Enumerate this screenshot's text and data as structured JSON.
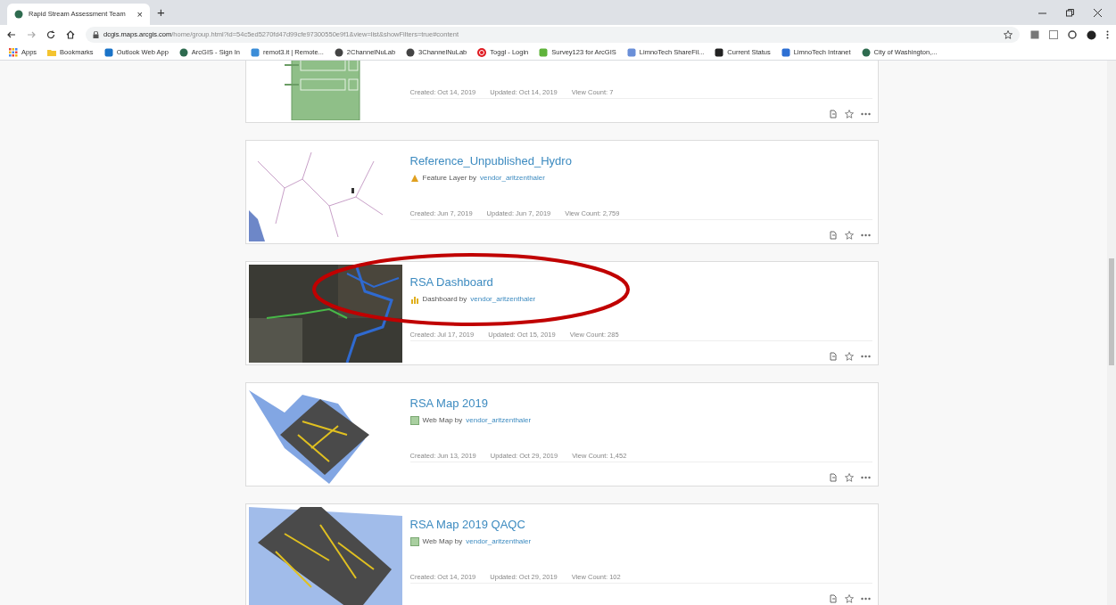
{
  "browser": {
    "tab": {
      "title": "Rapid Stream Assessment Team",
      "close": "×"
    },
    "new_tab": "+",
    "url_host": "dcgis.maps.arcgis.com",
    "url_path": "/home/group.html?id=54c5ed5270fd47d99cfe97300550e9f1&view=list&showFilters=true#content",
    "bookmarks": [
      {
        "kind": "apps",
        "label": "Apps"
      },
      {
        "kind": "folder",
        "label": "Bookmarks"
      },
      {
        "kind": "outlook",
        "label": "Outlook Web App"
      },
      {
        "kind": "arcgis",
        "label": "ArcGIS - Sign In"
      },
      {
        "kind": "remote",
        "label": "remot3.it | Remote..."
      },
      {
        "kind": "globe",
        "label": "2ChannelNuLab"
      },
      {
        "kind": "globe",
        "label": "3ChannelNuLab"
      },
      {
        "kind": "toggl",
        "label": "Toggl - Login"
      },
      {
        "kind": "survey",
        "label": "Survey123 for ArcGIS"
      },
      {
        "kind": "sharefile",
        "label": "LimnoTech ShareFil..."
      },
      {
        "kind": "status",
        "label": "Current Status"
      },
      {
        "kind": "intranet",
        "label": "LimnoTech Intranet"
      },
      {
        "kind": "arcgis",
        "label": "City of Washington,..."
      }
    ]
  },
  "items": [
    {
      "kind": "form",
      "created": "Created: Oct 14, 2019",
      "updated": "Updated: Oct 14, 2019",
      "views": "View Count: 7",
      "highlight": false
    },
    {
      "kind": "hydro",
      "title": "Reference_Unpublished_Hydro",
      "type": {
        "kind": "feature",
        "text": "Feature Layer by"
      },
      "owner": "vendor_aritzenthaler",
      "created": "Created: Jun 7, 2019",
      "updated": "Updated: Jun 7, 2019",
      "views": "View Count: 2,759",
      "highlight": false
    },
    {
      "kind": "imagery",
      "title": "RSA Dashboard",
      "type": {
        "kind": "dashboard",
        "text": "Dashboard by"
      },
      "owner": "vendor_aritzenthaler",
      "created": "Created: Jul 17, 2019",
      "updated": "Updated: Oct 15, 2019",
      "views": "View Count: 285",
      "highlight": true
    },
    {
      "kind": "map",
      "title": "RSA Map 2019",
      "type": {
        "kind": "webmap",
        "text": "Web Map by"
      },
      "owner": "vendor_aritzenthaler",
      "created": "Created: Jun 13, 2019",
      "updated": "Updated: Oct 29, 2019",
      "views": "View Count: 1,452",
      "highlight": false
    },
    {
      "kind": "mapzoom",
      "title": "RSA Map 2019 QAQC",
      "type": {
        "kind": "webmap",
        "text": "Web Map by"
      },
      "owner": "vendor_aritzenthaler",
      "created": "Created: Oct 14, 2019",
      "updated": "Updated: Oct 29, 2019",
      "views": "View Count: 102",
      "highlight": false
    }
  ]
}
